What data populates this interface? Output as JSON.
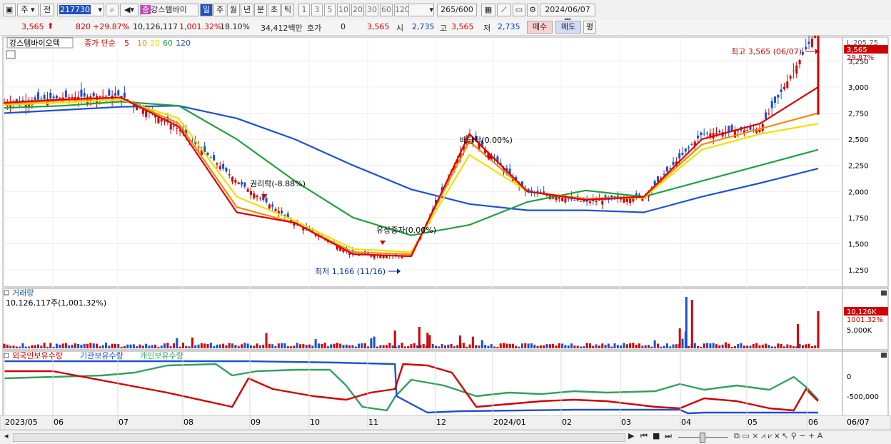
{
  "toolbar": {
    "market": "주",
    "all": "전",
    "code": "217730",
    "stock_name": "강스템바이",
    "stock_badge": "증",
    "periods": [
      "일",
      "주",
      "월",
      "년",
      "분",
      "초",
      "틱"
    ],
    "active_period": "일",
    "intervals": [
      "1",
      "3",
      "5",
      "10",
      "20",
      "30",
      "60",
      "120"
    ],
    "count": "265",
    "count_total": "/600",
    "date": "2024/06/07"
  },
  "quote": {
    "price": "3,565",
    "change": "820",
    "change_pct": "+29.87%",
    "volume": "10,126,117",
    "volume_pct": "1,001.32%",
    "turnover": "18.10%",
    "amount": "34,412백만",
    "hoga_label": "호가",
    "hoga_value": "0",
    "hoga_price": "3,565",
    "open_label": "시",
    "open": "2,735",
    "high_label": "고",
    "high": "3,565",
    "low_label": "저",
    "low": "2,735",
    "buy": "매수",
    "sell": "매도",
    "eval": "평"
  },
  "price_panel": {
    "title": "강스템바이오텍",
    "ma_label": "종가 단순",
    "ma_periods": [
      "5",
      "10",
      "20",
      "60",
      "120"
    ],
    "ma_colors": [
      "#e00000",
      "#f08c00",
      "#f0e000",
      "#20a040",
      "#2050d0"
    ],
    "y_labels": [
      "3,250",
      "3,000",
      "2,750",
      "2,500",
      "2,250",
      "2,000",
      "1,750",
      "1,500",
      "1,250"
    ],
    "right_top": "L:205.75",
    "last_price": "3,565",
    "last_pct": "29.87%",
    "ann_high": "최고 3,565 (06/07)",
    "ann_low": "최저 1,166 (11/16)",
    "ann_dividend": "배당락(0.00%)",
    "ann_rights": "권리락(-8.88%)",
    "ann_capital": "유상증자(0.00%)"
  },
  "volume_panel": {
    "title": "거래량",
    "value": "10,126,117주(1,001.32%)",
    "last_label": "10,126K",
    "last_pct": "1001.32%",
    "tick": "5,000K"
  },
  "holding_panel": {
    "labels": [
      "외국인보유수량",
      "기관보유수량",
      "개인보유수량"
    ],
    "colors": [
      "#d00000",
      "#2050d0",
      "#30a060"
    ],
    "y_labels": [
      "0",
      "-500,000"
    ]
  },
  "x_axis": [
    "2023/05",
    "06",
    "07",
    "08",
    "09",
    "10",
    "11",
    "12",
    "2024/01",
    "02",
    "03",
    "04",
    "05",
    "06"
  ],
  "x_axis_right": "06/07",
  "chart_data": [
    {
      "type": "line",
      "title": "강스템바이오텍",
      "x": [
        "2023/05",
        "06",
        "07",
        "08",
        "09",
        "10",
        "11",
        "12",
        "2024/01",
        "02",
        "03",
        "04",
        "05",
        "06",
        "06/07"
      ],
      "series": [
        {
          "name": "종가",
          "values": [
            2850,
            2900,
            2920,
            2600,
            2100,
            1700,
            1400,
            1380,
            2550,
            2000,
            1900,
            1950,
            2550,
            2600,
            3565
          ]
        },
        {
          "name": "5",
          "values": [
            2850,
            2880,
            2900,
            2620,
            1800,
            1700,
            1400,
            1380,
            2550,
            2000,
            1920,
            1950,
            2500,
            2650,
            3000
          ]
        },
        {
          "name": "10",
          "values": [
            2840,
            2870,
            2900,
            2650,
            1850,
            1700,
            1420,
            1400,
            2480,
            2000,
            1930,
            1950,
            2450,
            2600,
            2750
          ]
        },
        {
          "name": "20",
          "values": [
            2830,
            2850,
            2880,
            2700,
            1950,
            1720,
            1450,
            1420,
            2350,
            2000,
            1930,
            1940,
            2400,
            2550,
            2650
          ]
        },
        {
          "name": "60",
          "values": [
            2800,
            2820,
            2860,
            2820,
            2500,
            2100,
            1750,
            1580,
            1680,
            1900,
            2010,
            1950,
            2100,
            2250,
            2400
          ]
        },
        {
          "name": "120",
          "values": [
            2750,
            2780,
            2810,
            2820,
            2700,
            2500,
            2250,
            2020,
            1880,
            1820,
            1820,
            1800,
            1950,
            2080,
            2220
          ]
        }
      ],
      "ylim": [
        1100,
        3450
      ],
      "annotations": [
        "최고 3,565 (06/07)",
        "최저 1,166 (11/16)"
      ]
    },
    {
      "type": "bar",
      "title": "거래량",
      "values": [
        10126117
      ]
    }
  ],
  "status": {
    "nav_buttons": [
      "▶",
      "⏮",
      "■",
      "⏭"
    ]
  }
}
